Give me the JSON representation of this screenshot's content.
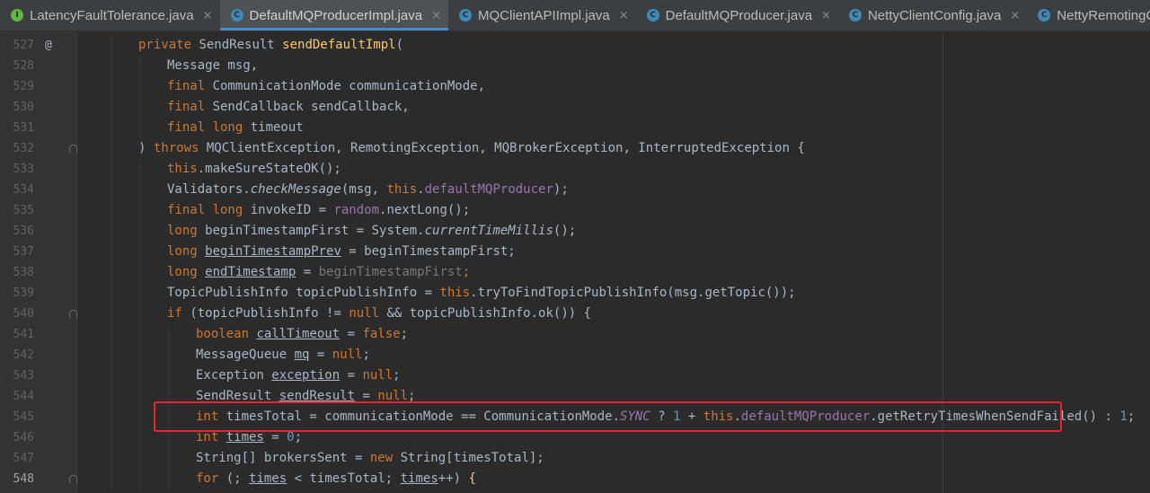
{
  "tabs": [
    {
      "label": "LatencyFaultTolerance.java",
      "icon": "interface-file-icon",
      "icon_letter": "I",
      "active": false
    },
    {
      "label": "DefaultMQProducerImpl.java",
      "icon": "class-file-icon",
      "icon_letter": "C",
      "active": true
    },
    {
      "label": "MQClientAPIImpl.java",
      "icon": "class-file-icon",
      "icon_letter": "C",
      "active": false
    },
    {
      "label": "DefaultMQProducer.java",
      "icon": "class-file-icon",
      "icon_letter": "C",
      "active": false
    },
    {
      "label": "NettyClientConfig.java",
      "icon": "class-file-icon",
      "icon_letter": "C",
      "active": false
    },
    {
      "label": "NettyRemotingClient.java",
      "icon": "class-file-icon",
      "icon_letter": "C",
      "active": false
    }
  ],
  "tab_close_glyph": "×",
  "gutter_marker": "@",
  "highlight_color": "#e8242c",
  "lines": [
    {
      "n": "527",
      "marker": "@",
      "indent": 8,
      "segs": [
        [
          "kw",
          "private "
        ],
        [
          "",
          "SendResult "
        ],
        [
          "fn",
          "sendDefaultImpl"
        ],
        [
          "",
          "("
        ]
      ]
    },
    {
      "n": "528",
      "indent": 12,
      "segs": [
        [
          "",
          "Message msg,"
        ]
      ]
    },
    {
      "n": "529",
      "indent": 12,
      "segs": [
        [
          "kw",
          "final "
        ],
        [
          "",
          "CommunicationMode communicationMode,"
        ]
      ]
    },
    {
      "n": "530",
      "indent": 12,
      "segs": [
        [
          "kw",
          "final "
        ],
        [
          "",
          "SendCallback sendCallback,"
        ]
      ]
    },
    {
      "n": "531",
      "indent": 12,
      "segs": [
        [
          "kw",
          "final long "
        ],
        [
          "",
          "timeout"
        ]
      ]
    },
    {
      "n": "532",
      "indent": 8,
      "fold": "open",
      "segs": [
        [
          "",
          ") "
        ],
        [
          "kw",
          "throws "
        ],
        [
          "",
          "MQClientException, RemotingException, MQBrokerException, InterruptedException {"
        ]
      ]
    },
    {
      "n": "533",
      "indent": 12,
      "segs": [
        [
          "kw",
          "this"
        ],
        [
          "",
          ".makeSureStateOK();"
        ]
      ]
    },
    {
      "n": "534",
      "indent": 12,
      "segs": [
        [
          "",
          "Validators."
        ],
        [
          "it",
          "checkMessage"
        ],
        [
          "",
          "(msg, "
        ],
        [
          "kw",
          "this"
        ],
        [
          "",
          "."
        ],
        [
          "fld",
          "defaultMQProducer"
        ],
        [
          "",
          ");"
        ]
      ]
    },
    {
      "n": "535",
      "indent": 12,
      "segs": [
        [
          "kw",
          "final long "
        ],
        [
          "",
          "invokeID = "
        ],
        [
          "fld",
          "random"
        ],
        [
          "",
          ".nextLong();"
        ]
      ]
    },
    {
      "n": "536",
      "indent": 12,
      "segs": [
        [
          "kw",
          "long "
        ],
        [
          "",
          "beginTimestampFirst = System."
        ],
        [
          "it",
          "currentTimeMillis"
        ],
        [
          "",
          "();"
        ]
      ]
    },
    {
      "n": "537",
      "indent": 12,
      "segs": [
        [
          "kw",
          "long "
        ],
        [
          "ul",
          "beginTimestampPrev"
        ],
        [
          "",
          " = beginTimestampFirst;"
        ]
      ]
    },
    {
      "n": "538",
      "indent": 12,
      "segs": [
        [
          "kw",
          "long "
        ],
        [
          "ul",
          "endTimestamp"
        ],
        [
          "",
          " = "
        ],
        [
          "gr",
          "beginTimestampFirst"
        ],
        [
          "kw",
          ";"
        ]
      ]
    },
    {
      "n": "539",
      "indent": 12,
      "segs": [
        [
          "",
          "TopicPublishInfo topicPublishInfo = "
        ],
        [
          "kw",
          "this"
        ],
        [
          "",
          ".tryToFindTopicPublishInfo(msg.getTopic());"
        ]
      ]
    },
    {
      "n": "540",
      "indent": 12,
      "fold": "open",
      "segs": [
        [
          "kw",
          "if "
        ],
        [
          "",
          "(topicPublishInfo != "
        ],
        [
          "kw",
          "null "
        ],
        [
          "",
          "&& topicPublishInfo.ok()) {"
        ]
      ]
    },
    {
      "n": "541",
      "indent": 16,
      "segs": [
        [
          "kw",
          "boolean "
        ],
        [
          "ul",
          "callTimeout"
        ],
        [
          "",
          " = "
        ],
        [
          "kw",
          "false"
        ],
        [
          "",
          ";"
        ]
      ]
    },
    {
      "n": "542",
      "indent": 16,
      "segs": [
        [
          "",
          "MessageQueue "
        ],
        [
          "ul",
          "mq"
        ],
        [
          "",
          " = "
        ],
        [
          "kw",
          "null"
        ],
        [
          "",
          ";"
        ]
      ]
    },
    {
      "n": "543",
      "indent": 16,
      "segs": [
        [
          "",
          "Exception "
        ],
        [
          "ul",
          "exception"
        ],
        [
          "",
          " = "
        ],
        [
          "kw",
          "null"
        ],
        [
          "",
          ";"
        ]
      ]
    },
    {
      "n": "544",
      "indent": 16,
      "segs": [
        [
          "",
          "SendResult "
        ],
        [
          "ul",
          "sendResult"
        ],
        [
          "",
          " = "
        ],
        [
          "kw",
          "null"
        ],
        [
          "",
          ";"
        ]
      ]
    },
    {
      "n": "545",
      "indent": 16,
      "segs": [
        [
          "kw",
          "int "
        ],
        [
          "",
          "timesTotal = communicationMode == CommunicationMode."
        ],
        [
          "itf",
          "SYNC"
        ],
        [
          "",
          " ? "
        ],
        [
          "num",
          "1"
        ],
        [
          "",
          " + "
        ],
        [
          "kw",
          "this"
        ],
        [
          "",
          "."
        ],
        [
          "fld",
          "defaultMQProducer"
        ],
        [
          "",
          ".getRetryTimesWhenSendFailed() : "
        ],
        [
          "num",
          "1"
        ],
        [
          "",
          ";"
        ]
      ]
    },
    {
      "n": "546",
      "indent": 16,
      "segs": [
        [
          "kw",
          "int "
        ],
        [
          "ul",
          "times"
        ],
        [
          "",
          " = "
        ],
        [
          "num",
          "0"
        ],
        [
          "",
          ";"
        ]
      ]
    },
    {
      "n": "547",
      "indent": 16,
      "segs": [
        [
          "",
          "String[] brokersSent = "
        ],
        [
          "kw",
          "new "
        ],
        [
          "",
          "String[timesTotal];"
        ]
      ]
    },
    {
      "n": "548",
      "indent": 16,
      "current": true,
      "fold": "open",
      "segs": [
        [
          "kw",
          "for "
        ],
        [
          "",
          "(; "
        ],
        [
          "ul",
          "times"
        ],
        [
          "",
          " < timesTotal; "
        ],
        [
          "ul",
          "times"
        ],
        [
          "",
          "++) "
        ],
        [
          "fn",
          "{"
        ]
      ]
    }
  ]
}
